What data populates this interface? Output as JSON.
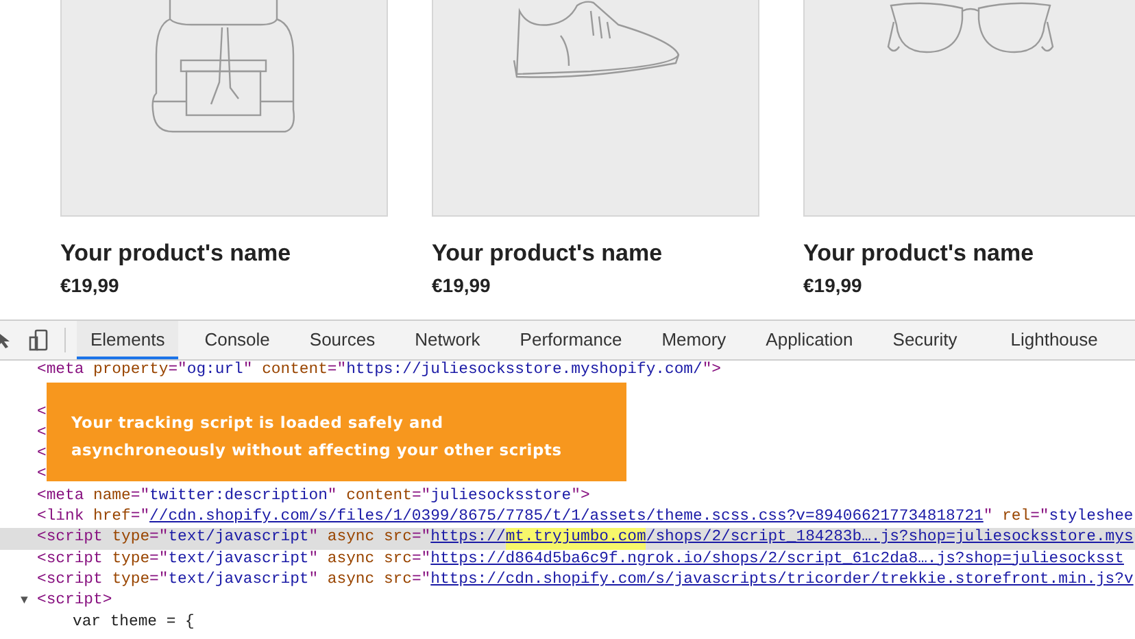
{
  "products": [
    {
      "kind": "backpack",
      "name": "Your product's name",
      "price": "€19,99"
    },
    {
      "kind": "sneaker",
      "name": "Your product's name",
      "price": "€19,99"
    },
    {
      "kind": "glasses",
      "name": "Your product's name",
      "price": "€19,99"
    }
  ],
  "devtools": {
    "tabs": [
      {
        "label": "Elements",
        "selected": true
      },
      {
        "label": "Console",
        "selected": false
      },
      {
        "label": "Sources",
        "selected": false
      },
      {
        "label": "Network",
        "selected": false
      },
      {
        "label": "Performance",
        "selected": false
      },
      {
        "label": "Memory",
        "selected": false
      },
      {
        "label": "Application",
        "selected": false
      },
      {
        "label": "Security",
        "selected": false
      },
      {
        "label": "Lighthouse",
        "selected": false
      }
    ],
    "lines": [
      {
        "selected": false,
        "tokens": [
          {
            "kind": "tag",
            "t": "<meta "
          },
          {
            "kind": "attr",
            "t": "property"
          },
          {
            "kind": "tag",
            "t": "=\""
          },
          {
            "kind": "value",
            "t": "og:url"
          },
          {
            "kind": "tag",
            "t": "\" "
          },
          {
            "kind": "attr",
            "t": "content"
          },
          {
            "kind": "tag",
            "t": "=\""
          },
          {
            "kind": "value",
            "t": "https://juliesocksstore.myshopify.com/"
          },
          {
            "kind": "tag",
            "t": "\">"
          }
        ]
      },
      {
        "selected": false
      },
      {
        "selected": false,
        "tokens": [
          {
            "kind": "tag",
            "t": "<"
          }
        ]
      },
      {
        "selected": false,
        "tokens": [
          {
            "kind": "tag",
            "t": "<"
          }
        ]
      },
      {
        "selected": false,
        "tokens": [
          {
            "kind": "tag",
            "t": "<"
          }
        ]
      },
      {
        "selected": false,
        "tokens": [
          {
            "kind": "tag",
            "t": "<"
          }
        ]
      },
      {
        "selected": false,
        "tokens": [
          {
            "kind": "tag",
            "t": "<meta "
          },
          {
            "kind": "attr",
            "t": "name"
          },
          {
            "kind": "tag",
            "t": "=\""
          },
          {
            "kind": "value",
            "t": "twitter:description"
          },
          {
            "kind": "tag",
            "t": "\" "
          },
          {
            "kind": "attr",
            "t": "content"
          },
          {
            "kind": "tag",
            "t": "=\""
          },
          {
            "kind": "value",
            "t": "juliesocksstore"
          },
          {
            "kind": "tag",
            "t": "\">"
          }
        ]
      },
      {
        "selected": false,
        "tokens": [
          {
            "kind": "tag",
            "t": "<link "
          },
          {
            "kind": "attr",
            "t": "href"
          },
          {
            "kind": "tag",
            "t": "=\""
          },
          {
            "kind": "link",
            "t": "//cdn.shopify.com/s/files/1/0399/8675/7785/t/1/assets/theme.scss.css?v=894066217734818721"
          },
          {
            "kind": "tag",
            "t": "\" "
          },
          {
            "kind": "attr",
            "t": "rel"
          },
          {
            "kind": "tag",
            "t": "=\""
          },
          {
            "kind": "value",
            "t": "styleshee"
          }
        ]
      },
      {
        "selected": true,
        "tokens": [
          {
            "kind": "tag",
            "t": "<script "
          },
          {
            "kind": "attr",
            "t": "type"
          },
          {
            "kind": "tag",
            "t": "=\""
          },
          {
            "kind": "value",
            "t": "text/javascript"
          },
          {
            "kind": "tag",
            "t": "\" "
          },
          {
            "kind": "attr",
            "t": "async "
          },
          {
            "kind": "attr",
            "t": "src"
          },
          {
            "kind": "tag",
            "t": "=\""
          },
          {
            "kind": "link",
            "t": "https://"
          },
          {
            "kind": "mark",
            "t": "mt.tryjumbo.com"
          },
          {
            "kind": "link",
            "t": "/shops/2/script_184283b….js?shop=juliesocksstore.mys"
          }
        ]
      },
      {
        "selected": false,
        "tokens": [
          {
            "kind": "tag",
            "t": "<script "
          },
          {
            "kind": "attr",
            "t": "type"
          },
          {
            "kind": "tag",
            "t": "=\""
          },
          {
            "kind": "value",
            "t": "text/javascript"
          },
          {
            "kind": "tag",
            "t": "\" "
          },
          {
            "kind": "attr",
            "t": "async "
          },
          {
            "kind": "attr",
            "t": "src"
          },
          {
            "kind": "tag",
            "t": "=\""
          },
          {
            "kind": "link",
            "t": "https://d864d5ba6c9f.ngrok.io/shops/2/script_61c2da8….js?shop=juliesocksst"
          }
        ]
      },
      {
        "selected": false,
        "tokens": [
          {
            "kind": "tag",
            "t": "<script "
          },
          {
            "kind": "attr",
            "t": "type"
          },
          {
            "kind": "tag",
            "t": "=\""
          },
          {
            "kind": "value",
            "t": "text/javascript"
          },
          {
            "kind": "tag",
            "t": "\" "
          },
          {
            "kind": "attr",
            "t": "async "
          },
          {
            "kind": "attr",
            "t": "src"
          },
          {
            "kind": "tag",
            "t": "=\""
          },
          {
            "kind": "link",
            "t": "https://cdn.shopify.com/s/javascripts/tricorder/trekkie.storefront.min.js?v"
          }
        ]
      },
      {
        "selected": false,
        "toggle": "▼",
        "expanded": true,
        "tokens": [
          {
            "kind": "tag",
            "t": "<script>"
          }
        ],
        "children": [
          {
            "selected": false,
            "tokens": [
              {
                "kind": "plain",
                "t": "var theme = {"
              }
            ]
          }
        ]
      }
    ]
  },
  "banner": {
    "text": "Your tracking script is loaded safely and asynchroneously without affecting your other scripts"
  }
}
